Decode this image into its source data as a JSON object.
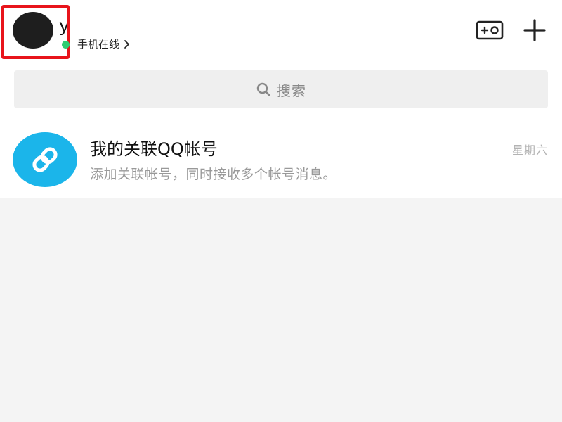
{
  "header": {
    "username": "y",
    "status_text": "手机在线",
    "status_color": "#2ecc71",
    "highlight_color": "#e8141b",
    "icons": {
      "status_chevron": "chevron-right-icon",
      "game": "game-controller-icon",
      "plus": "plus-icon"
    }
  },
  "search": {
    "placeholder": "搜索",
    "icon": "search-icon"
  },
  "list": {
    "items": [
      {
        "icon": "link-icon",
        "icon_color": "#1bb5ea",
        "title": "我的关联QQ帐号",
        "subtitle": "添加关联帐号，同时接收多个帐号消息。",
        "time": "星期六"
      }
    ]
  }
}
